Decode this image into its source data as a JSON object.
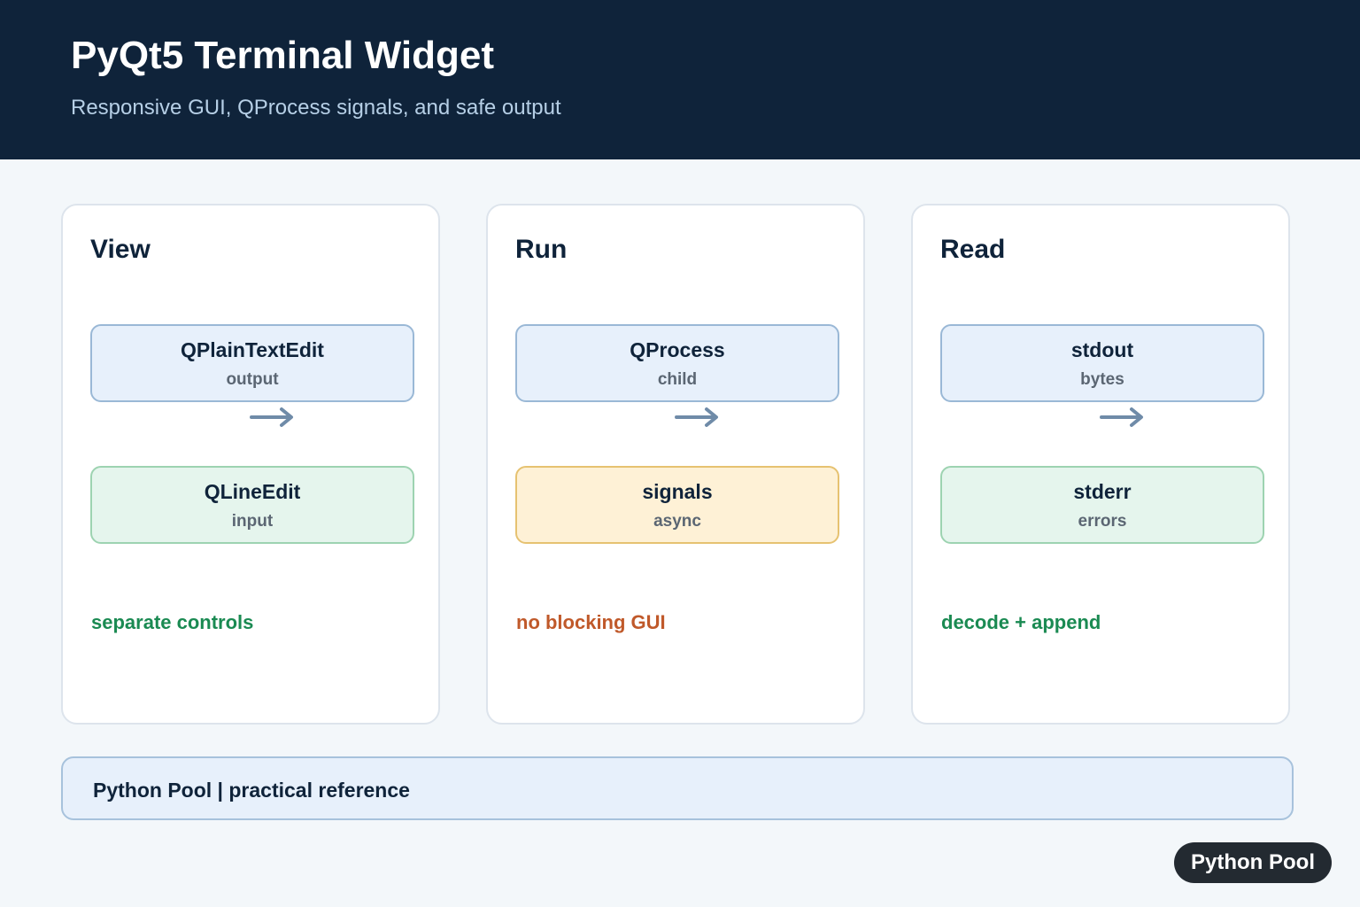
{
  "header": {
    "title": "PyQt5 Terminal Widget",
    "subtitle": "Responsive GUI, QProcess signals, and safe output"
  },
  "columns": [
    {
      "title": "View",
      "top_node": {
        "label": "QPlainTextEdit",
        "sublabel": "output",
        "color": "#e7f0fb"
      },
      "bottom_node": {
        "label": "QLineEdit",
        "sublabel": "input",
        "color": "#e5f5ed"
      },
      "note": "separate controls",
      "note_color": "#1a8a52"
    },
    {
      "title": "Run",
      "top_node": {
        "label": "QProcess",
        "sublabel": "child",
        "color": "#e7f0fb"
      },
      "bottom_node": {
        "label": "signals",
        "sublabel": "async",
        "color": "#fef1d6"
      },
      "note": "no blocking GUI",
      "note_color": "#c0592a"
    },
    {
      "title": "Read",
      "top_node": {
        "label": "stdout",
        "sublabel": "bytes",
        "color": "#e7f0fb"
      },
      "bottom_node": {
        "label": "stderr",
        "sublabel": "errors",
        "color": "#e5f5ed"
      },
      "note": "decode + append",
      "note_color": "#1a8a52"
    }
  ],
  "footer": {
    "text": "Python Pool | practical reference"
  },
  "badge": {
    "text": "Python Pool"
  },
  "icons": {
    "flow_arrow": "right-arrow-icon"
  },
  "colors": {
    "header_bg": "#0f233a",
    "arrow": "#6f8ba8"
  }
}
